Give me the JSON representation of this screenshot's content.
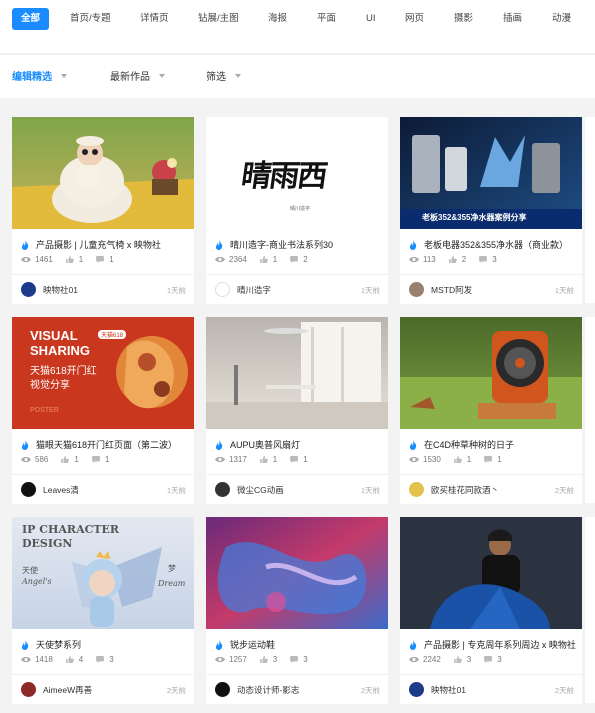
{
  "tabs": [
    {
      "label": "全部",
      "active": true
    },
    {
      "label": "首页/专题"
    },
    {
      "label": "详情页"
    },
    {
      "label": "钻展/主图"
    },
    {
      "label": "海报"
    },
    {
      "label": "平面"
    },
    {
      "label": "UI"
    },
    {
      "label": "网页"
    },
    {
      "label": "摄影"
    },
    {
      "label": "插画"
    },
    {
      "label": "动漫"
    }
  ],
  "filters": [
    {
      "label": "编辑精选",
      "active": true
    },
    {
      "label": "最新作品"
    },
    {
      "label": "筛选"
    }
  ],
  "cards": [
    {
      "title": "产品摄影 | 儿童充气椅 x 映物社",
      "views": "1461",
      "likes": "1",
      "comments": "1",
      "author": "映物社01",
      "time": "1天前"
    },
    {
      "title": "晴川造字-商业书法系列30",
      "views": "2364",
      "likes": "1",
      "comments": "2",
      "author": "晴川造字",
      "time": "1天前",
      "thumb_text": {
        "calligraphy": "晴雨西",
        "seal": "晴川造字"
      }
    },
    {
      "title": "老板电器352&355净水器（商业款）",
      "views": "113",
      "likes": "2",
      "comments": "3",
      "author": "MSTD阿发",
      "time": "1天前",
      "thumb_text": {
        "banner": "老板352&355净水器案例分享"
      }
    },
    {
      "title": "猫眼天猫618开门红页面（第二波）",
      "views": "586",
      "likes": "1",
      "comments": "1",
      "author": "Leaves清",
      "time": "1天前",
      "thumb_text": {
        "line1": "VISUAL",
        "line2": "SHARING",
        "badge": "天猫618",
        "cn1": "天猫618开门红",
        "cn2": "视觉分享",
        "poster": "POSTER"
      }
    },
    {
      "title": "AUPU奥普风扇灯",
      "views": "1317",
      "likes": "1",
      "comments": "1",
      "author": "微尘CG动画",
      "time": "1天前"
    },
    {
      "title": "在C4D种草种树的日子",
      "views": "1530",
      "likes": "1",
      "comments": "1",
      "author": "欧买桂花同款酒丶",
      "time": "2天前"
    },
    {
      "title": "天使梦系列",
      "views": "1418",
      "likes": "4",
      "comments": "3",
      "author": "AimeeW再善",
      "time": "2天前",
      "thumb_text": {
        "h1": "IP CHARACTER",
        "h2": "DESIGN",
        "left_cn": "天使",
        "left_en": "Angel's",
        "right_cn": "梦",
        "right_en": "Dream"
      }
    },
    {
      "title": "锐步运动鞋",
      "views": "1257",
      "likes": "3",
      "comments": "3",
      "author": "动态设计师-影志",
      "time": "2天前"
    },
    {
      "title": "产品摄影 | 专克周年系列周边 x 映物社",
      "views": "2242",
      "likes": "3",
      "comments": "3",
      "author": "映物社01",
      "time": "2天前"
    }
  ],
  "colors": {
    "accent": "#1a8cff",
    "page_bg": "#f3f3f3",
    "card_bg": "#ffffff"
  },
  "icons": {
    "hot": "fire-icon",
    "views": "eye-icon",
    "likes": "thumb-up-icon",
    "comments": "comment-icon",
    "filter_menu": "caret-down-icon"
  }
}
